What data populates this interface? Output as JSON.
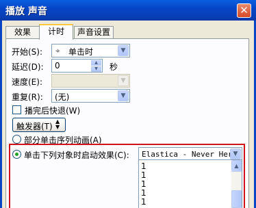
{
  "window": {
    "title": "播放 声音"
  },
  "tabs": [
    {
      "label": "效果"
    },
    {
      "label": "计时"
    },
    {
      "label": "声音设置"
    }
  ],
  "timing": {
    "start_label": "开始(S):",
    "start_icon": "mouse-icon",
    "start_value": "单击时",
    "delay_label": "延迟(D):",
    "delay_value": "0",
    "delay_unit": "秒",
    "speed_label": "速度(E):",
    "speed_value": "",
    "repeat_label": "重复(R):",
    "repeat_value": "(无)",
    "rewind_label": "播完后快退(W)",
    "rewind_checked": false,
    "triggers_button": "触发器(T)",
    "option_sequence": "部分单击序列动画(A)",
    "option_on_click": "单击下列对象时启动效果(C):",
    "selected_option": "on_click",
    "trigger_object": "Elastica - Never Here.",
    "list_items": [
      "1",
      "1",
      "1",
      "1",
      "1"
    ]
  },
  "colors": {
    "highlight_border": "#d0121a",
    "titlebar": "#0a5ee0"
  }
}
